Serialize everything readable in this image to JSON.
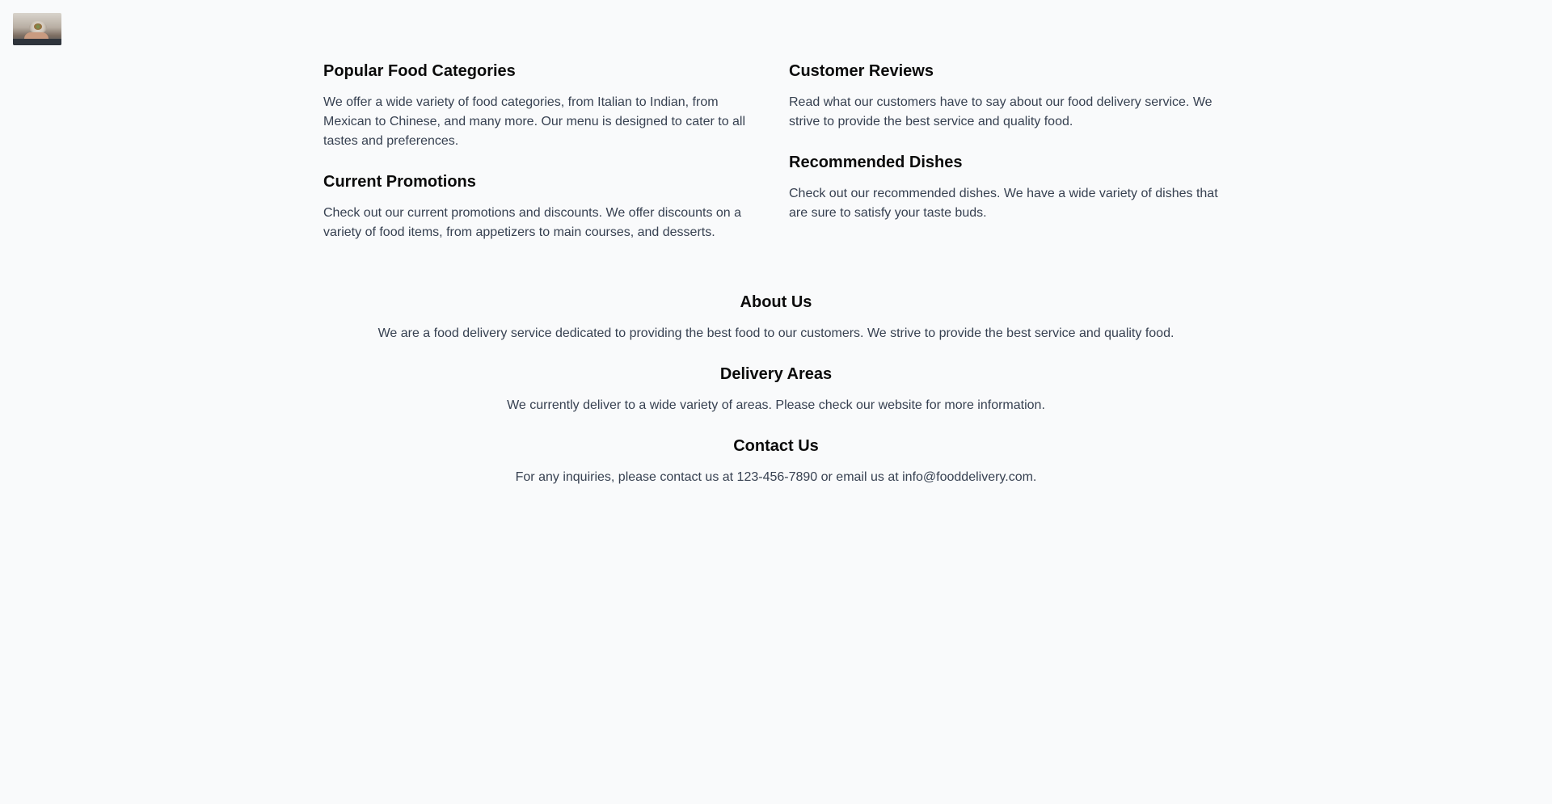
{
  "logo": {
    "icon": "food-delivery-logo-image"
  },
  "left_column": [
    {
      "title": "Popular Food Categories",
      "text": "We offer a wide variety of food categories, from Italian to Indian, from Mexican to Chinese, and many more. Our menu is designed to cater to all tastes and preferences."
    },
    {
      "title": "Current Promotions",
      "text": "Check out our current promotions and discounts. We offer discounts on a variety of food items, from appetizers to main courses, and desserts."
    }
  ],
  "right_column": [
    {
      "title": "Customer Reviews",
      "text": "Read what our customers have to say about our food delivery service. We strive to provide the best service and quality food."
    },
    {
      "title": "Recommended Dishes",
      "text": "Check out our recommended dishes. We have a wide variety of dishes that are sure to satisfy your taste buds."
    }
  ],
  "about": {
    "title": "About Us",
    "text": "We are a food delivery service dedicated to providing the best food to our customers. We strive to provide the best service and quality food."
  },
  "delivery": {
    "title": "Delivery Areas",
    "text": "We currently deliver to a wide variety of areas. Please check our website for more information."
  },
  "contact": {
    "title": "Contact Us",
    "text": "For any inquiries, please contact us at 123-456-7890 or email us at info@fooddelivery.com."
  }
}
